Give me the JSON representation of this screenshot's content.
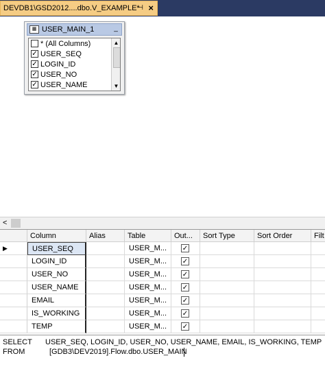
{
  "tab": {
    "title": "DEVDB1\\GSD2012....dbo.V_EXAMPLE*",
    "pin_icon": "pin-icon",
    "close_icon": "close-icon"
  },
  "table_box": {
    "title": "USER_MAIN_1",
    "columns": [
      {
        "label": "* (All Columns)",
        "checked": false
      },
      {
        "label": "USER_SEQ",
        "checked": true
      },
      {
        "label": "LOGIN_ID",
        "checked": true
      },
      {
        "label": "USER_NO",
        "checked": true
      },
      {
        "label": "USER_NAME",
        "checked": true
      }
    ]
  },
  "grid": {
    "headers": [
      "Column",
      "Alias",
      "Table",
      "Out...",
      "Sort Type",
      "Sort Order",
      "Filt"
    ],
    "rows": [
      {
        "column": "USER_SEQ",
        "alias": "",
        "table": "USER_M...",
        "output": true
      },
      {
        "column": "LOGIN_ID",
        "alias": "",
        "table": "USER_M...",
        "output": true
      },
      {
        "column": "USER_NO",
        "alias": "",
        "table": "USER_M...",
        "output": true
      },
      {
        "column": "USER_NAME",
        "alias": "",
        "table": "USER_M...",
        "output": true
      },
      {
        "column": "EMAIL",
        "alias": "",
        "table": "USER_M...",
        "output": true
      },
      {
        "column": "IS_WORKING",
        "alias": "",
        "table": "USER_M...",
        "output": true
      },
      {
        "column": "TEMP",
        "alias": "",
        "table": "USER_M...",
        "output": true
      }
    ]
  },
  "sql": {
    "select_kw": "SELECT",
    "select_list": "USER_SEQ, LOGIN_ID, USER_NO, USER_NAME, EMAIL, IS_WORKING, TEMP",
    "from_kw": "FROM",
    "from_source": "[GDB3\\DEV2019].Flow.dbo.USER_MAIN"
  }
}
